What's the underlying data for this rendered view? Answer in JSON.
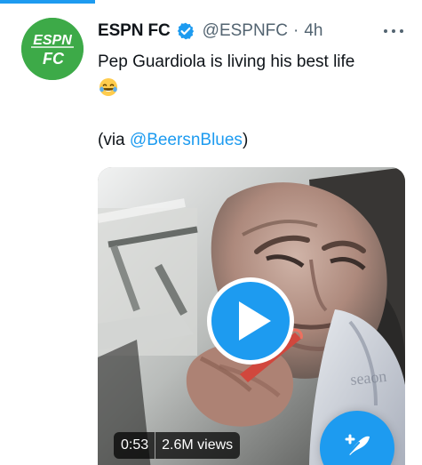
{
  "tweet": {
    "author": {
      "display_name": "ESPN FC",
      "handle": "@ESPNFC",
      "avatar_text": {
        "line1": "ESPN",
        "line2": "FC"
      }
    },
    "separator": "·",
    "timestamp": "4h",
    "text": "Pep Guardiola is living his best life",
    "emoji_name": "tears-of-joy-emoji",
    "via": {
      "prefix": "(via ",
      "mention": "@BeersnBlues",
      "suffix": ")"
    },
    "video": {
      "duration": "0:53",
      "views": "2.6M views"
    }
  },
  "ui": {
    "more_icon": "more-dots-icon",
    "verified_icon": "verified-badge-icon",
    "play_icon": "play-icon",
    "compose_icon": "compose-tweet-icon"
  },
  "colors": {
    "accent": "#1d9bf0",
    "avatar_green": "#3daa48",
    "secondary_text": "#536471",
    "primary_text": "#0f1419"
  }
}
